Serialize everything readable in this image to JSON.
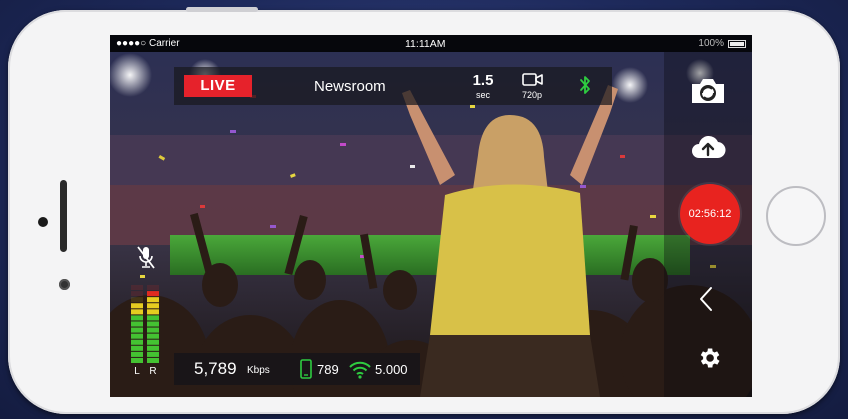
{
  "status_bar": {
    "carrier": "●●●●○ Carrier",
    "time": "11:11AM",
    "battery": "100%"
  },
  "top_bar": {
    "live_label": "LIVE",
    "channel_name": "Newsroom",
    "latency_value": "1.5",
    "latency_unit": "sec",
    "resolution": "720p"
  },
  "record_button": {
    "timer": "02:56:12"
  },
  "audio_meter": {
    "left_label": "L",
    "right_label": "R",
    "left_level": 0.74,
    "right_level": 0.9
  },
  "bottom_bar": {
    "bitrate_value": "5,789",
    "bitrate_unit": "Kbps",
    "cellular_value": "789",
    "wifi_value": "5.000"
  },
  "colors": {
    "live_red": "#e6222b",
    "record_red": "#e8231f",
    "bluetooth_green": "#2ecc40",
    "meter_green": "#44c232",
    "meter_yellow": "#e6cc20",
    "meter_red": "#e02a20"
  },
  "icons": {
    "switch_camera": "camera-switch-icon",
    "upload": "cloud-upload-icon",
    "collapse": "chevron-left-icon",
    "settings": "gear-icon",
    "mute": "mic-muted-icon",
    "bluetooth": "bluetooth-icon",
    "resolution": "video-camera-icon",
    "cellular": "smartphone-icon",
    "wifi": "wifi-icon"
  }
}
